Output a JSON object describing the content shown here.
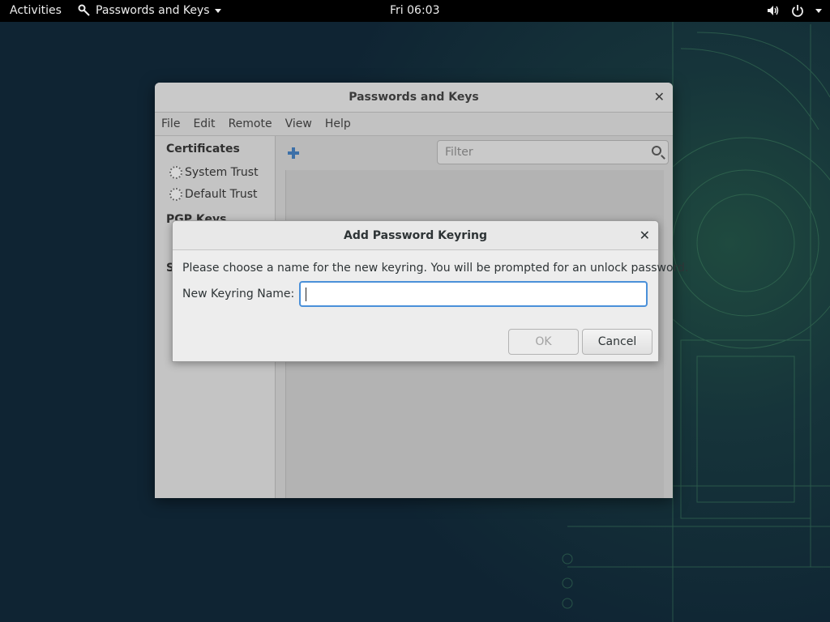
{
  "topbar": {
    "activities": "Activities",
    "app_name": "Passwords and Keys",
    "clock": "Fri 06:03"
  },
  "window": {
    "title": "Passwords and Keys",
    "menu": [
      "File",
      "Edit",
      "Remote",
      "View",
      "Help"
    ],
    "sidebar": {
      "certificates_heading": "Certificates",
      "items": [
        "System Trust",
        "Default Trust"
      ],
      "pgp_heading": "PGP Keys",
      "partial_heading": "S"
    },
    "filter_placeholder": "Filter"
  },
  "dialog": {
    "title": "Add Password Keyring",
    "message": "Please choose a name for the new keyring. You will be prompted for an unlock password.",
    "name_label": "New Keyring Name:",
    "name_value": "",
    "ok_label": "OK",
    "cancel_label": "Cancel",
    "ok_enabled": false
  },
  "icons": {
    "app": "keys-icon",
    "volume": "volume-icon",
    "power": "power-icon",
    "add": "plus-icon",
    "search": "search-icon",
    "cert": "gear-icon"
  },
  "colors": {
    "accent": "#4a90d9",
    "add_icon": "#3d70a8"
  }
}
